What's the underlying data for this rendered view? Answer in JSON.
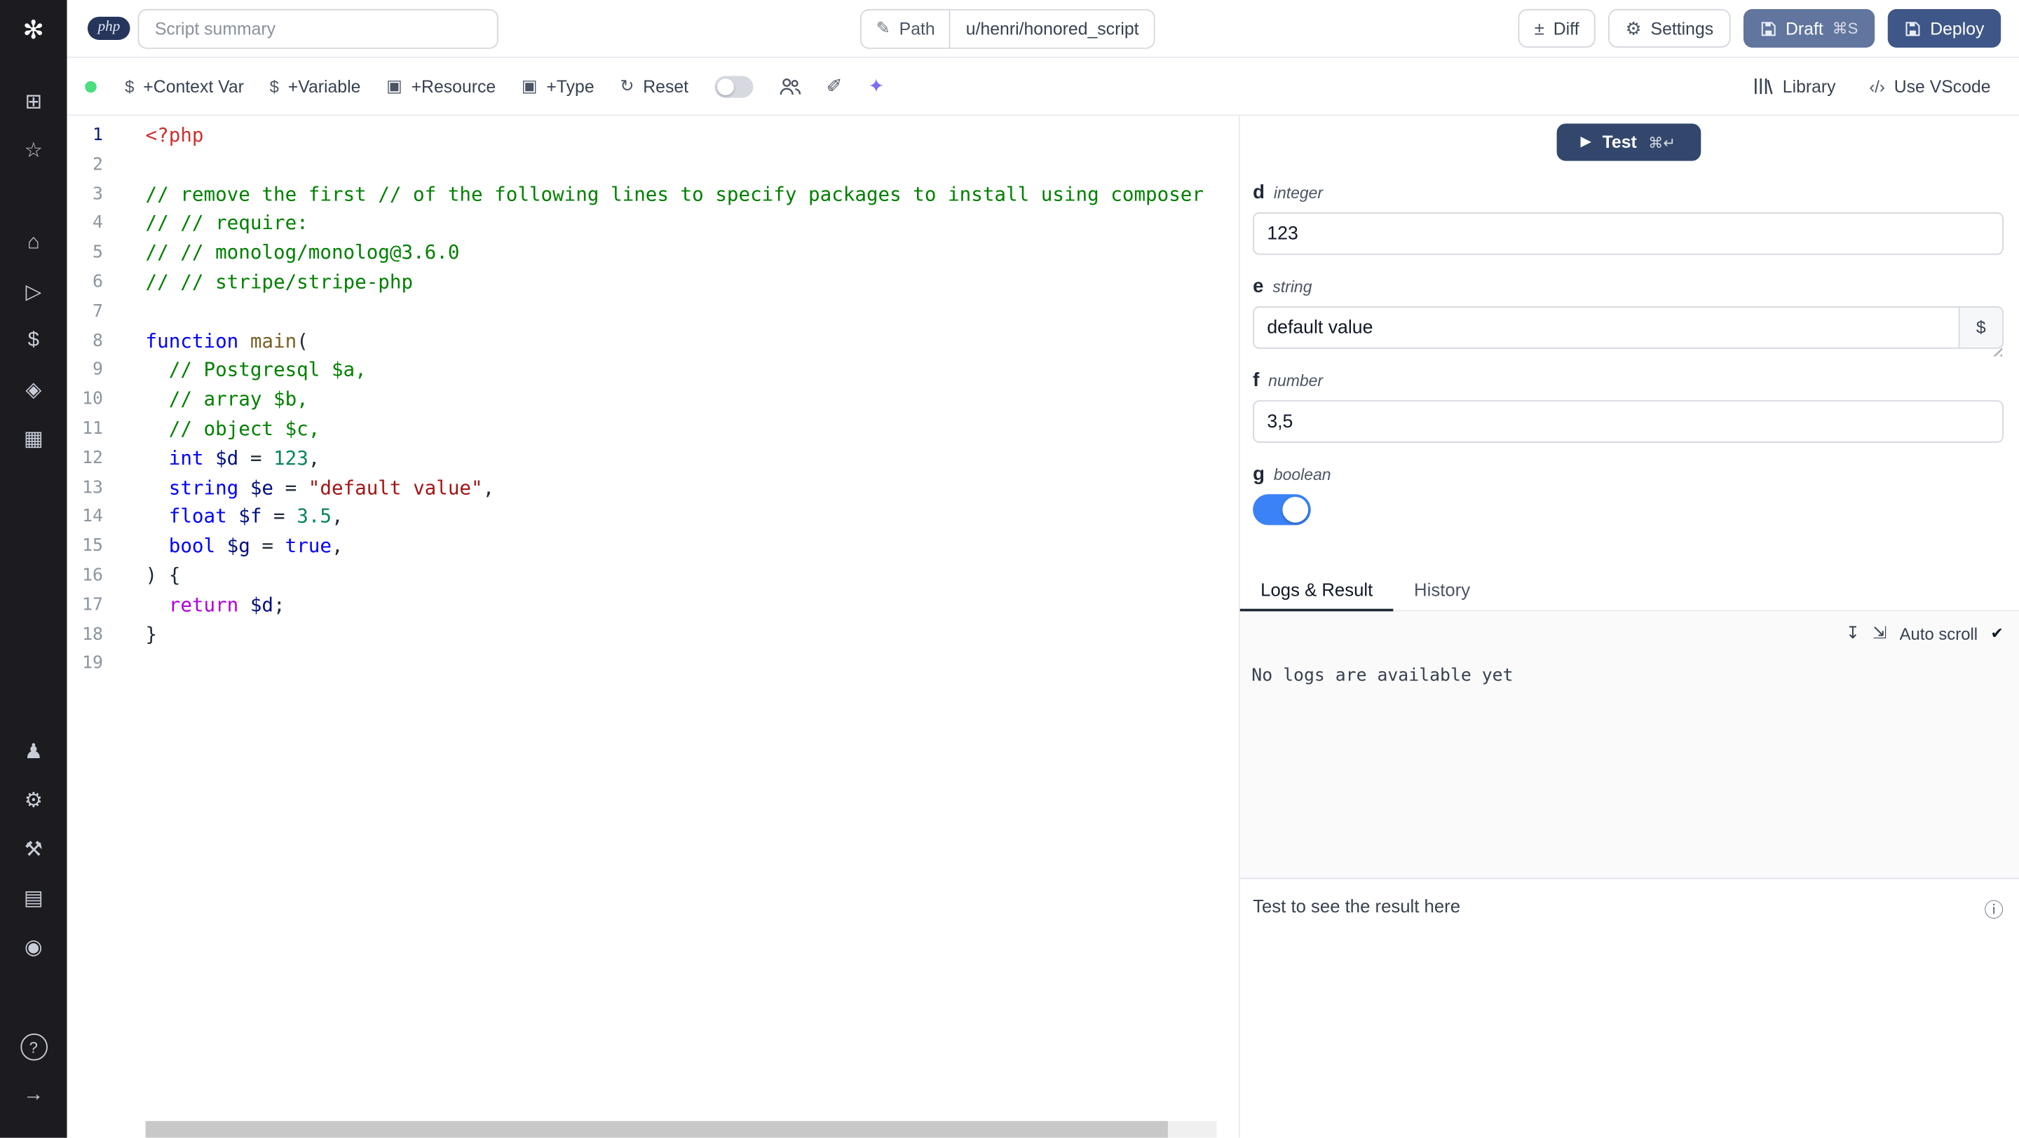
{
  "topbar": {
    "language_badge": "php",
    "summary_placeholder": "Script summary",
    "path_label": "Path",
    "path_value": "u/henri/honored_script",
    "diff_label": "Diff",
    "settings_label": "Settings",
    "draft_label": "Draft",
    "draft_shortcut": "⌘S",
    "deploy_label": "Deploy"
  },
  "toolbar": {
    "add_context_var": "+Context Var",
    "add_variable": "+Variable",
    "add_resource": "+Resource",
    "add_type": "+Type",
    "reset": "Reset",
    "library": "Library",
    "use_vscode": "Use VScode"
  },
  "icons": {
    "pencil": "✎",
    "diff": "±",
    "gear": "⚙",
    "dollar": "$",
    "package": "▣",
    "reset": "↻",
    "brush": "✐",
    "sparkles": "✦",
    "play": "▶",
    "download": "↧",
    "expand": "⇲",
    "check": "✔",
    "info": "ⓘ",
    "vscode": "‹/›",
    "logo": "✻"
  },
  "sidebar": {
    "groups": [
      [
        {
          "name": "apps",
          "glyph": "⊞"
        },
        {
          "name": "favorites",
          "glyph": "☆"
        }
      ],
      [
        {
          "name": "home",
          "glyph": "⌂"
        },
        {
          "name": "runs",
          "glyph": "▷"
        },
        {
          "name": "variables",
          "glyph": "$"
        },
        {
          "name": "resources",
          "glyph": "◈"
        },
        {
          "name": "schedules",
          "glyph": "▦"
        }
      ],
      [
        {
          "name": "user",
          "glyph": "♟"
        },
        {
          "name": "settings",
          "glyph": "⚙"
        },
        {
          "name": "workers",
          "glyph": "⚒"
        },
        {
          "name": "folders",
          "glyph": "▤"
        },
        {
          "name": "audit-logs",
          "glyph": "◉"
        }
      ],
      [
        {
          "name": "help",
          "glyph": "?",
          "circled": true
        },
        {
          "name": "collapse-sidebar",
          "glyph": "→"
        }
      ]
    ]
  },
  "editor": {
    "active_line": 1,
    "lines": [
      [
        {
          "t": "<?php",
          "c": "meta"
        }
      ],
      [],
      [
        {
          "t": "// remove the first // of the following lines to specify packages to install using composer",
          "c": "comment"
        }
      ],
      [
        {
          "t": "// // require:",
          "c": "comment"
        }
      ],
      [
        {
          "t": "// // monolog/monolog@3.6.0",
          "c": "comment"
        }
      ],
      [
        {
          "t": "// // stripe/stripe-php",
          "c": "comment"
        }
      ],
      [],
      [
        {
          "t": "function",
          "c": "kw"
        },
        {
          "t": " ",
          "c": "plain"
        },
        {
          "t": "main",
          "c": "fn"
        },
        {
          "t": "(",
          "c": "plain"
        }
      ],
      [
        {
          "t": "  ",
          "c": "plain"
        },
        {
          "t": "// Postgresql $a,",
          "c": "comment"
        }
      ],
      [
        {
          "t": "  ",
          "c": "plain"
        },
        {
          "t": "// array $b,",
          "c": "comment"
        }
      ],
      [
        {
          "t": "  ",
          "c": "plain"
        },
        {
          "t": "// object $c,",
          "c": "comment"
        }
      ],
      [
        {
          "t": "  ",
          "c": "plain"
        },
        {
          "t": "int",
          "c": "kw"
        },
        {
          "t": " ",
          "c": "plain"
        },
        {
          "t": "$d",
          "c": "var"
        },
        {
          "t": " = ",
          "c": "plain"
        },
        {
          "t": "123",
          "c": "num"
        },
        {
          "t": ",",
          "c": "plain"
        }
      ],
      [
        {
          "t": "  ",
          "c": "plain"
        },
        {
          "t": "string",
          "c": "kw"
        },
        {
          "t": " ",
          "c": "plain"
        },
        {
          "t": "$e",
          "c": "var"
        },
        {
          "t": " = ",
          "c": "plain"
        },
        {
          "t": "\"default value\"",
          "c": "str"
        },
        {
          "t": ",",
          "c": "plain"
        }
      ],
      [
        {
          "t": "  ",
          "c": "plain"
        },
        {
          "t": "float",
          "c": "kw"
        },
        {
          "t": " ",
          "c": "plain"
        },
        {
          "t": "$f",
          "c": "var"
        },
        {
          "t": " = ",
          "c": "plain"
        },
        {
          "t": "3.5",
          "c": "num"
        },
        {
          "t": ",",
          "c": "plain"
        }
      ],
      [
        {
          "t": "  ",
          "c": "plain"
        },
        {
          "t": "bool",
          "c": "kw"
        },
        {
          "t": " ",
          "c": "plain"
        },
        {
          "t": "$g",
          "c": "var"
        },
        {
          "t": " = ",
          "c": "plain"
        },
        {
          "t": "true",
          "c": "bool"
        },
        {
          "t": ",",
          "c": "plain"
        }
      ],
      [
        {
          "t": ") {",
          "c": "plain"
        }
      ],
      [
        {
          "t": "  ",
          "c": "plain"
        },
        {
          "t": "return",
          "c": "ctrl"
        },
        {
          "t": " ",
          "c": "plain"
        },
        {
          "t": "$d",
          "c": "var"
        },
        {
          "t": ";",
          "c": "plain"
        }
      ],
      [
        {
          "t": "}",
          "c": "plain"
        }
      ],
      []
    ]
  },
  "panel": {
    "test_label": "Test",
    "test_shortcut": "⌘↵",
    "fields": [
      {
        "name": "d",
        "type": "integer",
        "value": "123"
      },
      {
        "name": "e",
        "type": "string",
        "value": "default value"
      },
      {
        "name": "f",
        "type": "number",
        "value": "3,5"
      },
      {
        "name": "g",
        "type": "boolean",
        "value": true
      }
    ],
    "dollar_button": "$",
    "tabs": [
      "Logs & Result",
      "History"
    ],
    "auto_scroll_label": "Auto scroll",
    "no_logs_message": "No logs are available yet",
    "result_placeholder": "Test to see the result here"
  },
  "colors": {
    "accent_blue": "#3b82f6",
    "status_green": "#4ade80",
    "draft_button_bg": "#61759e",
    "deploy_button_bg": "#3e5688",
    "test_button_bg": "#32476b",
    "sidebar_bg": "#1b1b20"
  }
}
